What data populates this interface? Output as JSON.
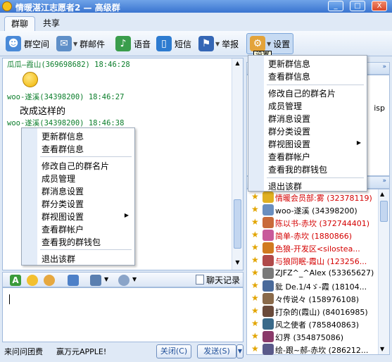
{
  "window": {
    "title": "情暖湛江志愿者2 — 高级群",
    "controls": [
      "_",
      "□",
      "X"
    ]
  },
  "tabs": [
    "群聊",
    "共享"
  ],
  "toolbar": {
    "group_space": "群空间",
    "group_mail": "群邮件",
    "voice": "语音",
    "sms": "短信",
    "report": "举报",
    "settings": "设置",
    "tooltip": "设置"
  },
  "chat": {
    "messages": [
      {
        "meta": "瓜瓜—霞山(369698682) 18:46:28",
        "body": ""
      },
      {
        "meta": "woo-遂溪(34398200) 18:46:27",
        "body": "改成这样的"
      },
      {
        "meta": "woo-遂溪(34398200) 18:46:38",
        "body": ""
      }
    ]
  },
  "menu": {
    "items": [
      "更新群信息",
      "查看群信息",
      "修改自己的群名片",
      "成员管理",
      "群消息设置",
      "群分类设置",
      "群视图设置",
      "查看群帐户",
      "查看我的群钱包",
      "退出该群"
    ]
  },
  "right_pane": {
    "partial_text": "isp",
    "members": [
      {
        "name": "情暖会员部:雾 (32378119)",
        "color": "#d40000"
      },
      {
        "name": "woo-遂溪 (34398200)",
        "color": "#000000"
      },
      {
        "name": "陈以书-赤坎 (372744401)",
        "color": "#d40000"
      },
      {
        "name": "简单-赤坎 (1880866)",
        "color": "#d40000"
      },
      {
        "name": "色狼-开发区<silostea...",
        "color": "#d40000"
      },
      {
        "name": "与狼同眠-霞山 (123256...",
        "color": "#d40000"
      },
      {
        "name": "ZJFZ^_^Alex (53365627)",
        "color": "#000000"
      },
      {
        "name": "豼 De.1/4ゞ-霞 (18104...",
        "color": "#000000"
      },
      {
        "name": "々传说々 (158976108)",
        "color": "#000000"
      },
      {
        "name": "打杂的(霞山) (84016985)",
        "color": "#000000"
      },
      {
        "name": "风之使者 (785840863)",
        "color": "#000000"
      },
      {
        "name": "幻界 (354875086)",
        "color": "#000000"
      },
      {
        "name": "绘-跟~郝-赤坎 (286212...",
        "color": "#000000"
      }
    ]
  },
  "bottom": {
    "history": "聊天记录",
    "left_text_1": "来问问团费",
    "left_text_2": "赢万元APPLE!",
    "close": "关闭(C)",
    "send": "发送(S)"
  }
}
